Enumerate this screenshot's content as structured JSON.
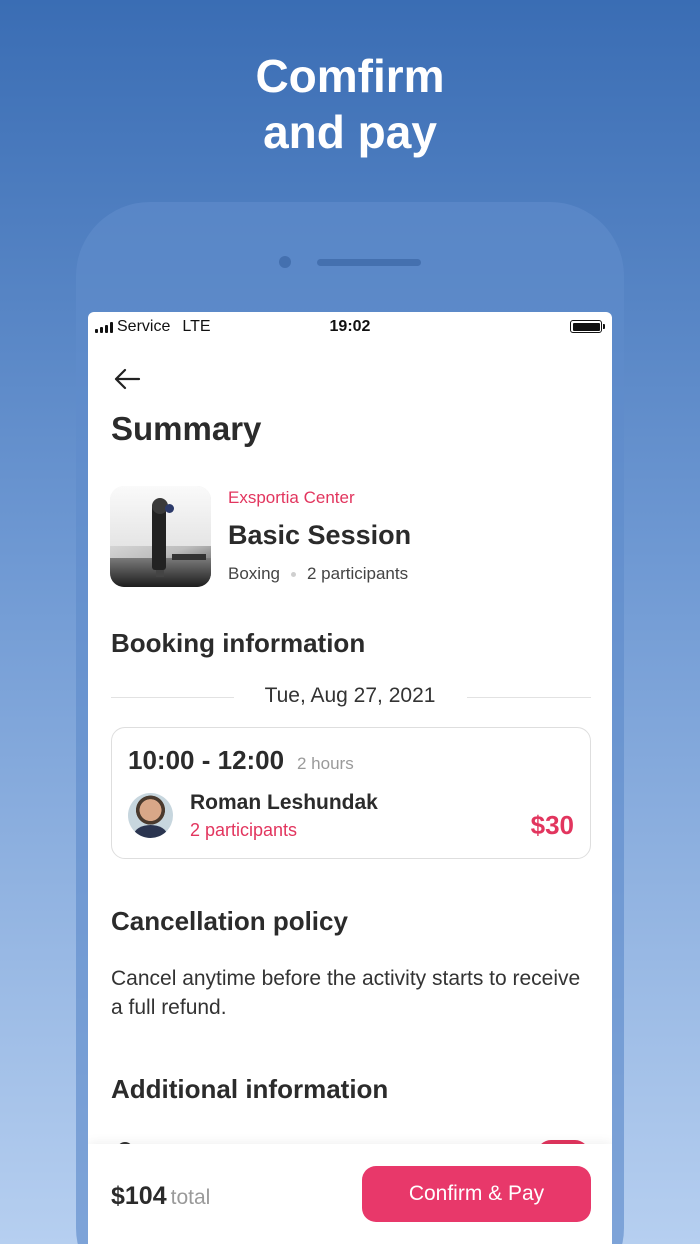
{
  "headline": {
    "line1": "Comfirm",
    "line2": "and pay"
  },
  "status_bar": {
    "carrier": "Service",
    "network": "LTE",
    "time": "19:02"
  },
  "screen": {
    "title": "Summary",
    "activity": {
      "venue": "Exsportia Center",
      "session_name": "Basic Session",
      "category": "Boxing",
      "participants": "2 participants"
    },
    "booking": {
      "section_title": "Booking information",
      "date": "Tue, Aug 27, 2021",
      "time_slot": "10:00 - 12:00",
      "duration": "2 hours",
      "guest_name": "Roman Leshundak",
      "guest_participants": "2 participants",
      "price": "$30"
    },
    "cancellation": {
      "section_title": "Cancellation policy",
      "text": "Cancel anytime before the activity starts to receive a full refund."
    },
    "additional": {
      "section_title": "Additional information"
    },
    "footer": {
      "total_amount": "$104",
      "total_label": "total",
      "pay_button": "Confirm & Pay"
    }
  },
  "colors": {
    "accent": "#e2355e",
    "button": "#e8386a",
    "background_top": "#3a6db4",
    "background_bottom": "#b6cff0"
  },
  "icons": {
    "back": "arrow-left-icon",
    "battery": "battery-icon",
    "signal": "signal-icon"
  }
}
